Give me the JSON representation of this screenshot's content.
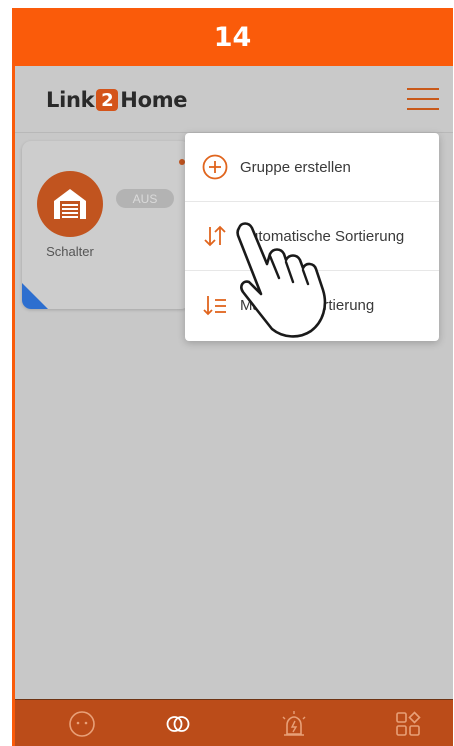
{
  "step": {
    "number": "14"
  },
  "header": {
    "logo_left": "Link",
    "logo_box": "2",
    "logo_right": "Home"
  },
  "device": {
    "name": "Schalter",
    "status": "AUS"
  },
  "menu": {
    "items": [
      {
        "label": "Gruppe erstellen",
        "icon": "add-circle-icon"
      },
      {
        "label": "Automatische Sortierung",
        "icon": "sort-arrows-icon"
      },
      {
        "label": "Manuelle Sortierung",
        "icon": "manual-sort-icon"
      }
    ]
  },
  "bottom_nav": {
    "items": [
      {
        "icon": "smiley-icon"
      },
      {
        "icon": "link-rings-icon"
      },
      {
        "icon": "alarm-siren-icon"
      },
      {
        "icon": "apps-grid-icon"
      }
    ]
  },
  "colors": {
    "accent": "#fa5b0a",
    "icon_orange": "#e0651e",
    "badge_blue": "#2e6fcf"
  }
}
